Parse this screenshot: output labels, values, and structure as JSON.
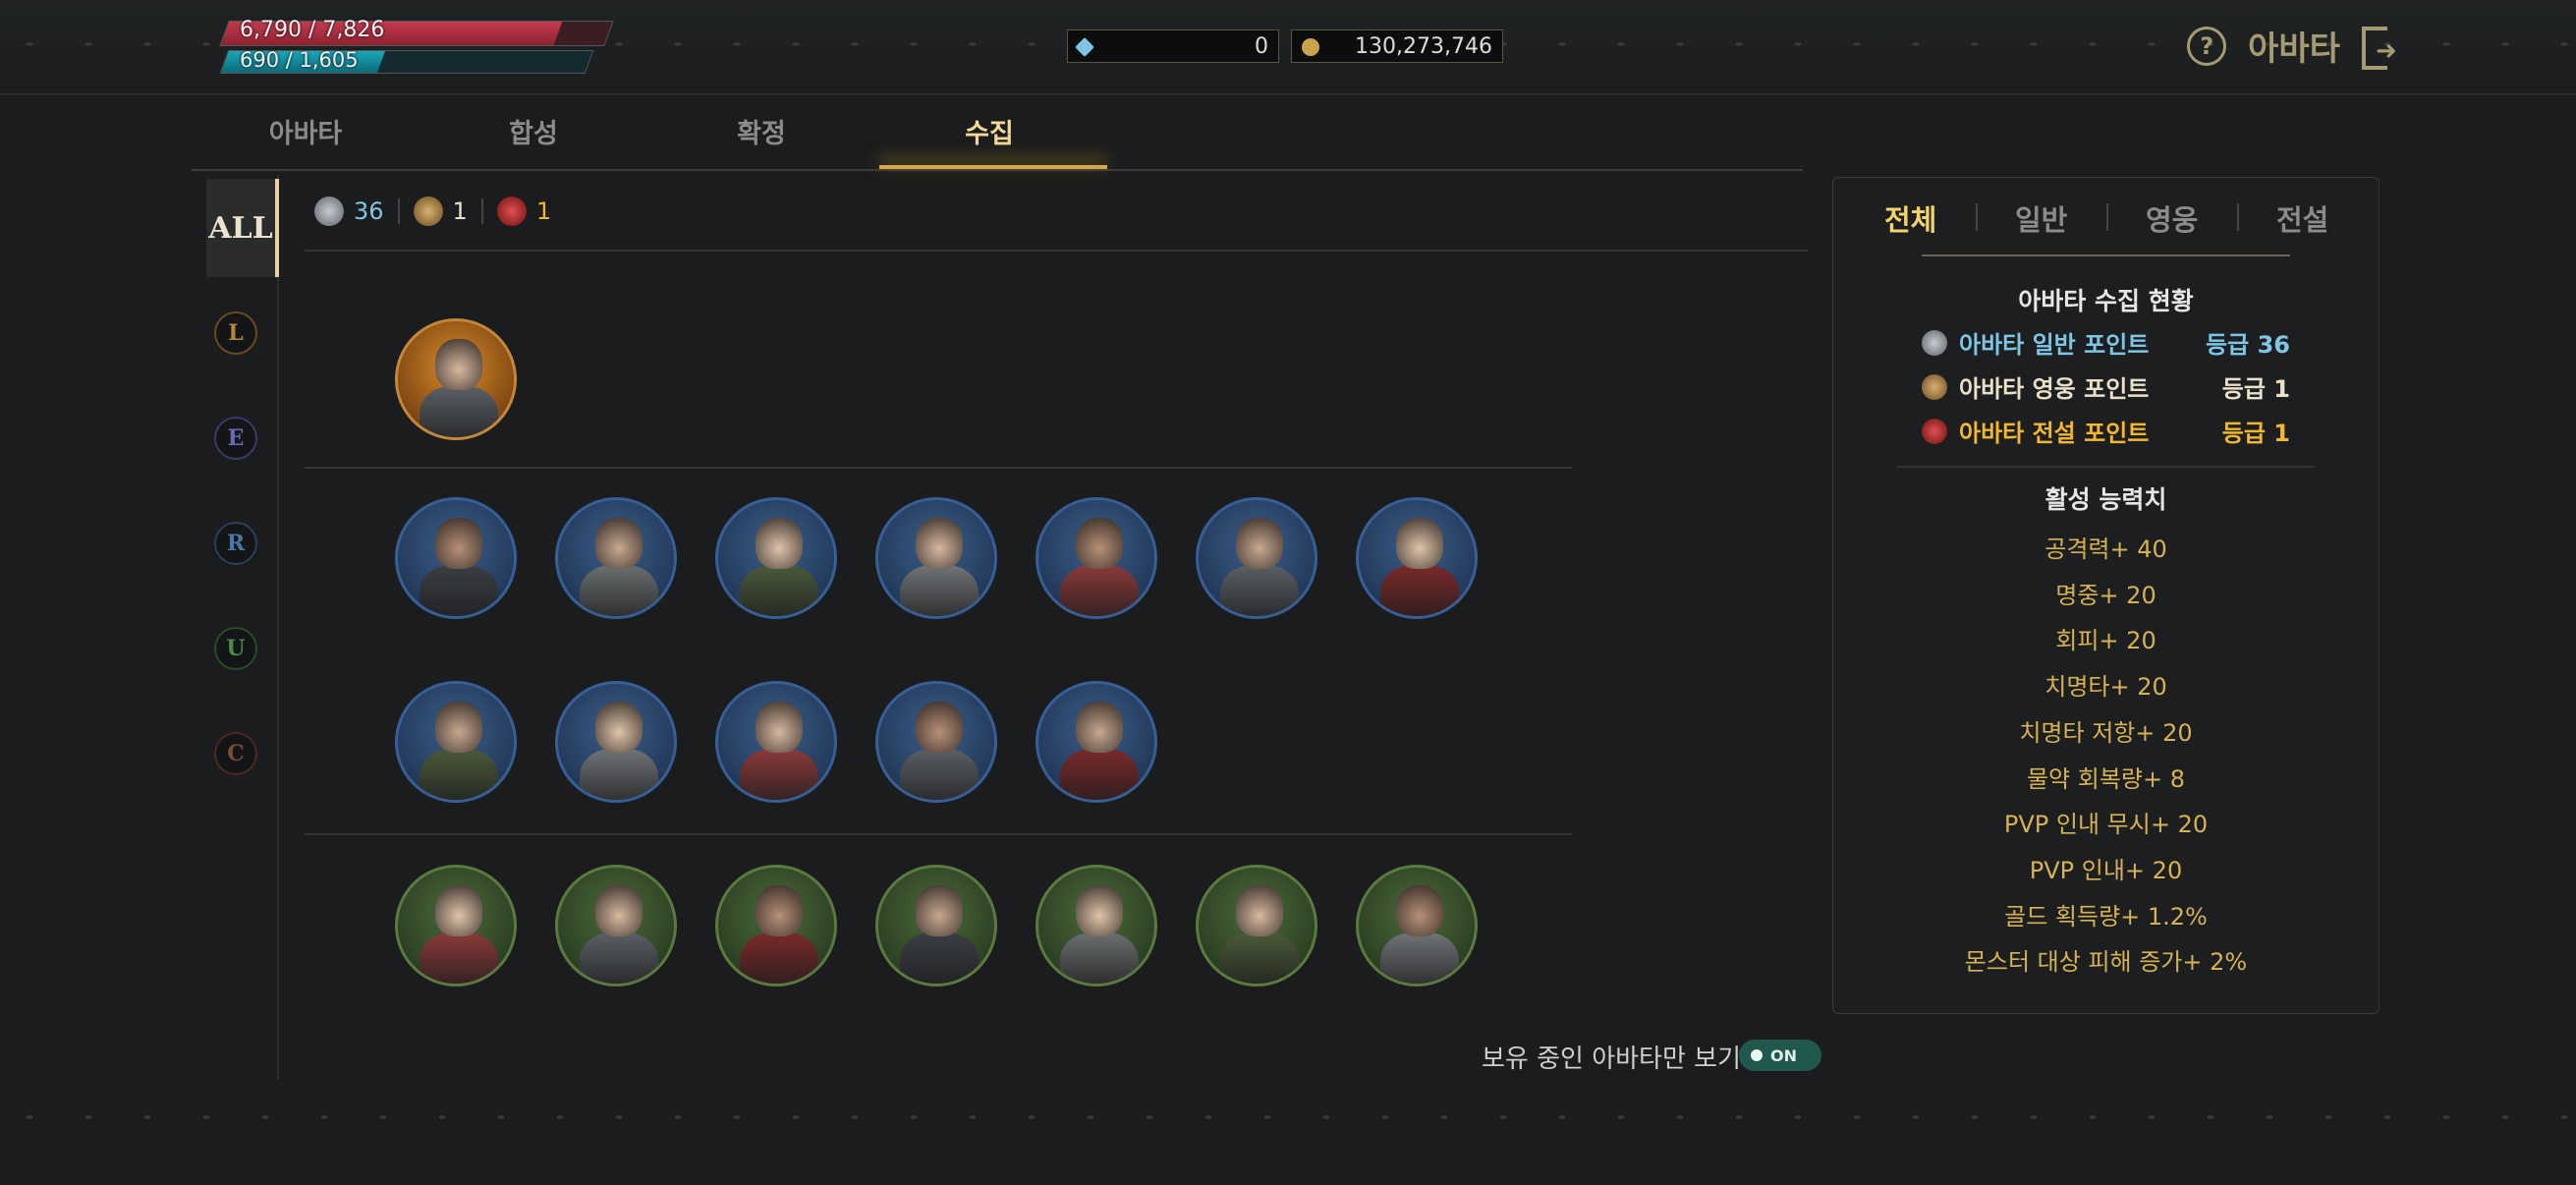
{
  "status": {
    "hp_text": "6,790 / 7,826",
    "hp_fraction": 0.868,
    "mp_text": "690 / 1,605",
    "mp_fraction": 0.43
  },
  "currency": {
    "diamond_value": "0",
    "gold_value": "130,273,746",
    "diamond_icon": "diamond-icon",
    "gold_icon": "gold-coin-icon"
  },
  "header": {
    "title": "아바타",
    "help_symbol": "?",
    "help_icon": "help-icon",
    "exit_icon": "exit-icon"
  },
  "tabs": [
    {
      "label": "아바타"
    },
    {
      "label": "합성"
    },
    {
      "label": "확정"
    },
    {
      "label": "수집",
      "active": true
    }
  ],
  "filters": {
    "all_label": "ALL",
    "grades": [
      "L",
      "E",
      "R",
      "U",
      "C"
    ]
  },
  "counts": {
    "normal": "36",
    "hero": "1",
    "legend": "1"
  },
  "avatar_rows": [
    {
      "tier": "legend",
      "count": 1
    },
    {
      "tier": "rare",
      "count": 7
    },
    {
      "tier": "rare",
      "count": 5
    },
    {
      "tier": "uncommon",
      "count": 7
    }
  ],
  "right_panel": {
    "tabs": [
      "전체",
      "일반",
      "영웅",
      "전설"
    ],
    "active_tab": "전체",
    "collection_title": "아바타 수집 현황",
    "points": [
      {
        "label": "아바타 일반 포인트",
        "value": "등급 36",
        "color": "#7fc6e6"
      },
      {
        "label": "아바타 영웅 포인트",
        "value": "등급 1",
        "color": "#e8e0c8"
      },
      {
        "label": "아바타 전설 포인트",
        "value": "등급 1",
        "color": "#f2b731"
      }
    ],
    "stats_title": "활성 능력치",
    "stats": [
      "공격력+ 40",
      "명중+ 20",
      "회피+ 20",
      "치명타+ 20",
      "치명타 저항+ 20",
      "물약 회복량+ 8",
      "PVP 인내 무시+ 20",
      "PVP 인내+ 20",
      "골드 획득량+ 1.2%",
      "몬스터 대상 피해 증가+ 2%"
    ]
  },
  "toggle": {
    "label": "보유 중인 아바타만 보기",
    "state": "ON"
  },
  "colors": {
    "accent_gold": "#d6b256",
    "tab_active": "#f1d899",
    "hp": "#c23b4e",
    "mp": "#1aa6b8",
    "legend_ring": "#c2873a",
    "rare_ring": "#385f95",
    "uncommon_ring": "#5a7a3f"
  }
}
